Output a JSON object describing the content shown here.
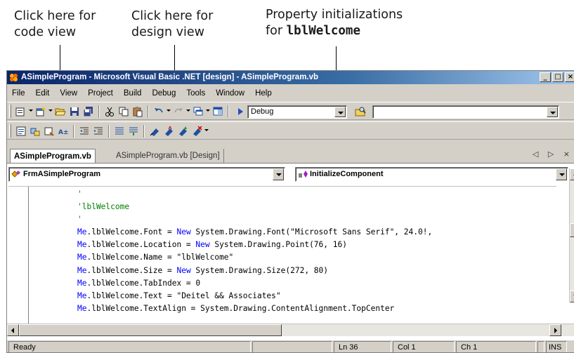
{
  "callouts": {
    "code_view": [
      "Click here for",
      "code view"
    ],
    "design_view": [
      "Click here for",
      "design view"
    ],
    "property_line1": "Property initializations",
    "property_line2_prefix": "for ",
    "property_line2_code": "lblWelcome"
  },
  "window": {
    "title": "ASimpleProgram - Microsoft Visual Basic .NET [design] - ASimpleProgram.vb",
    "controls": {
      "minimize": "_",
      "maximize": "□",
      "close": "×"
    }
  },
  "menu": [
    "File",
    "Edit",
    "View",
    "Project",
    "Build",
    "Debug",
    "Tools",
    "Window",
    "Help"
  ],
  "toolbar": {
    "config_value": "Debug"
  },
  "tabs": [
    {
      "label": "ASimpleProgram.vb",
      "active": true
    },
    {
      "label": "ASimpleProgram.vb [Design]",
      "active": false
    }
  ],
  "tab_nav": "◁ ▷ ×",
  "class_combo": "FrmASimpleProgram",
  "method_combo": "InitializeComponent",
  "code_lines": [
    [
      [
        "cm",
        "'"
      ]
    ],
    [
      [
        "cm",
        "'lblWelcome"
      ]
    ],
    [
      [
        "cm",
        "'"
      ]
    ],
    [
      [
        "kw",
        "Me"
      ],
      [
        "t",
        ".lblWelcome.Font = "
      ],
      [
        "kw",
        "New"
      ],
      [
        "t",
        " System.Drawing.Font(\"Microsoft Sans Serif\", 24.0!,"
      ]
    ],
    [
      [
        "kw",
        "Me"
      ],
      [
        "t",
        ".lblWelcome.Location = "
      ],
      [
        "kw",
        "New"
      ],
      [
        "t",
        " System.Drawing.Point(76, 16)"
      ]
    ],
    [
      [
        "kw",
        "Me"
      ],
      [
        "t",
        ".lblWelcome.Name = \"lblWelcome\""
      ]
    ],
    [
      [
        "kw",
        "Me"
      ],
      [
        "t",
        ".lblWelcome.Size = "
      ],
      [
        "kw",
        "New"
      ],
      [
        "t",
        " System.Drawing.Size(272, 80)"
      ]
    ],
    [
      [
        "kw",
        "Me"
      ],
      [
        "t",
        ".lblWelcome.TabIndex = 0"
      ]
    ],
    [
      [
        "kw",
        "Me"
      ],
      [
        "t",
        ".lblWelcome.Text = \"Deitel && Associates\""
      ]
    ],
    [
      [
        "kw",
        "Me"
      ],
      [
        "t",
        ".lblWelcome.TextAlign = System.Drawing.ContentAlignment.TopCenter"
      ]
    ]
  ],
  "status": {
    "message": "Ready",
    "line": "Ln 36",
    "col": "Col 1",
    "ch": "Ch 1",
    "mode": "INS"
  },
  "colors": {
    "keyword": "#0000ff",
    "comment": "#008000",
    "title_start": "#0a246a",
    "title_end": "#a6caf0",
    "chrome": "#d4d0c8"
  },
  "icons": [
    "add-item-icon",
    "new-project-icon",
    "open-icon",
    "save-icon",
    "save-all-icon",
    "cut-icon",
    "copy-icon",
    "paste-icon",
    "undo-icon",
    "redo-icon",
    "navigate-icon",
    "window-icon",
    "start-icon",
    "find-icon",
    "outdent-icon",
    "indent-icon",
    "comment-icon",
    "uncomment-icon",
    "bookmark-icon"
  ]
}
